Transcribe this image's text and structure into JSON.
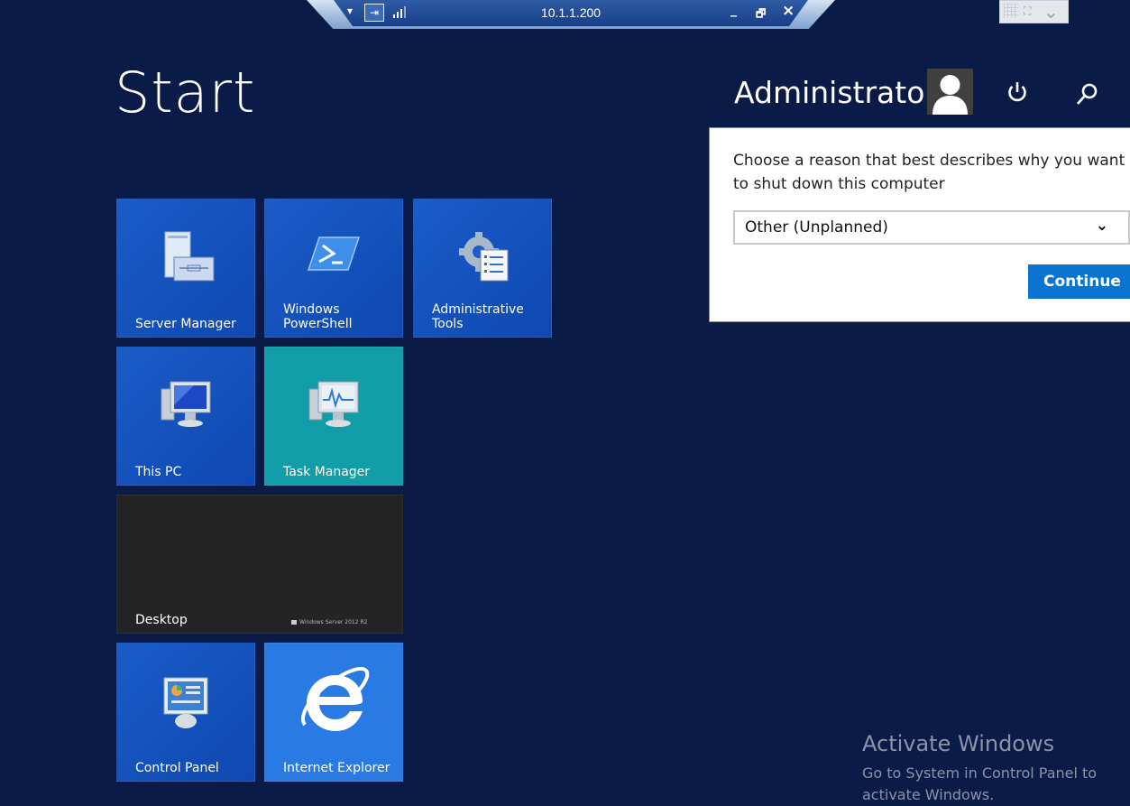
{
  "rdp_bar": {
    "host": "10.1.1.200",
    "minimize": "_",
    "restore": "🗗",
    "close": "×"
  },
  "start": {
    "title": "Start"
  },
  "user": {
    "name": "Administrator"
  },
  "tiles": [
    {
      "label": "Server Manager",
      "icon": "server-manager-icon",
      "color": "#1a5cc9"
    },
    {
      "label": "Windows\nPowerShell",
      "icon": "powershell-icon",
      "color": "#1a5cc9"
    },
    {
      "label": "Administrative\nTools",
      "icon": "admin-tools-icon",
      "color": "#1a5cc9"
    },
    {
      "label": "This PC",
      "icon": "this-pc-icon",
      "color": "#1a5cc9"
    },
    {
      "label": "Task Manager",
      "icon": "task-manager-icon",
      "color": "#129ea8"
    },
    {
      "label": "Desktop",
      "icon": "desktop-icon",
      "color": "#242424"
    },
    {
      "label": "Control Panel",
      "icon": "control-panel-icon",
      "color": "#1a5cc9"
    },
    {
      "label": "Internet Explorer",
      "icon": "internet-explorer-icon",
      "color": "#2a7ae3"
    }
  ],
  "desktop_brand": "Windows Server 2012 R2",
  "shutdown_dialog": {
    "message": "Choose a reason that best describes why you want to shut down this computer",
    "reason": "Other (Unplanned)",
    "continue": "Continue"
  },
  "activation": {
    "title": "Activate Windows",
    "subtitle": "Go to System in Control Panel to activate Windows."
  }
}
